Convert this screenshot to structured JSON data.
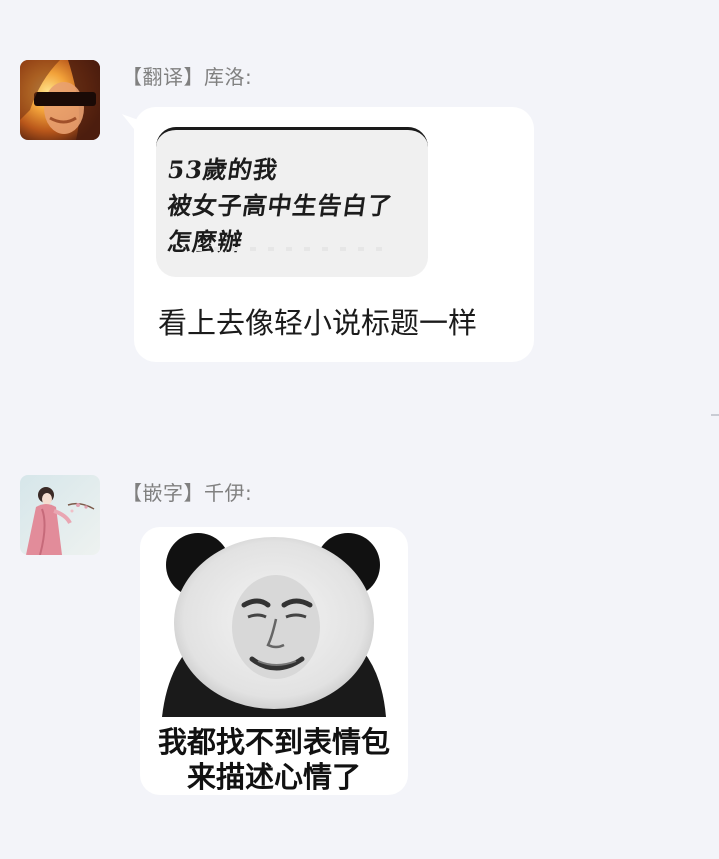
{
  "messages": [
    {
      "sender": "【翻译】库洛:",
      "avatar_icon": "user-avatar-hooded-figure",
      "quoted_image": {
        "lines": [
          "53歲的我",
          "被女子高中生告白了",
          "怎麼辦"
        ]
      },
      "text": "看上去像轻小说标题一样"
    },
    {
      "sender": "【嵌字】千伊:",
      "avatar_icon": "user-avatar-girl-pink-dress",
      "sticker": {
        "icon": "panda-face-meme-sticker",
        "caption_lines": [
          "我都找不到表情包",
          "来描述心情了"
        ]
      }
    }
  ],
  "colors": {
    "background": "#f3f4f9",
    "bubble": "#ffffff",
    "sender_text": "#808080",
    "message_text": "#1b1b1b"
  }
}
